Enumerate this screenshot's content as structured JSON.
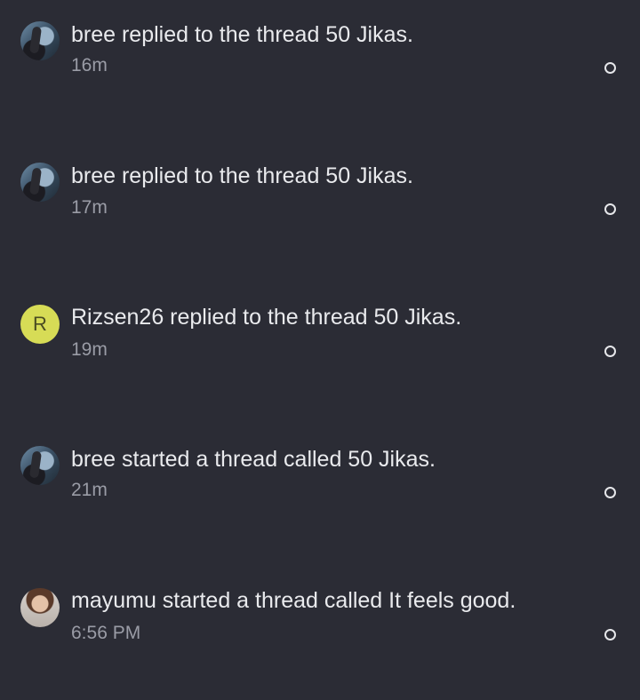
{
  "notifications": [
    {
      "user": "bree",
      "avatar": "photo",
      "message": "bree replied to the thread 50 Jikas.",
      "time": "16m",
      "unread": true
    },
    {
      "user": "bree",
      "avatar": "photo",
      "message": "bree replied to the thread 50 Jikas.",
      "time": "17m",
      "unread": true
    },
    {
      "user": "Rizsen26",
      "avatar": "letter",
      "avatar_letter": "R",
      "avatar_color": "#d7dc56",
      "message": "Rizsen26 replied to the thread 50 Jikas.",
      "time": "19m",
      "unread": true
    },
    {
      "user": "bree",
      "avatar": "photo",
      "message": "bree started a thread called 50 Jikas.",
      "time": "21m",
      "unread": true
    },
    {
      "user": "mayumu",
      "avatar": "photo",
      "message": "mayumu started a thread called It feels good.",
      "time": "6:56 PM",
      "unread": true
    }
  ],
  "colors": {
    "background": "#2b2c35",
    "text": "#e9eaed",
    "muted_text": "#9a9ca6"
  },
  "icons": {
    "unread_indicator": "hollow-circle-icon"
  }
}
